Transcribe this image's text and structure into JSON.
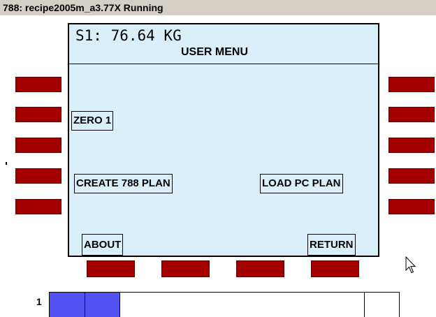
{
  "window": {
    "title": "788: recipe2005m_a3.77X Running"
  },
  "display": {
    "weight_readout": "S1: 76.64 KG",
    "menu_title": "USER MENU",
    "buttons": {
      "zero": "ZERO 1",
      "create_plan": "CREATE 788 PLAN",
      "load_plan": "LOAD PC PLAN",
      "about": "ABOUT",
      "return": "RETURN"
    }
  },
  "softkeys": {
    "color": "#a50000",
    "left_count": 5,
    "right_count": 5,
    "bottom_count": 4
  },
  "progress": {
    "index_label": "1",
    "fill_fraction": 0.2,
    "fill_color": "#5252f0",
    "segment_fractions": [
      0.1,
      0.2,
      0.9
    ]
  },
  "icons": {
    "cursor": "mouse-pointer-icon"
  },
  "colors": {
    "screen_background": "#d9f0fa",
    "titlebar_background": "#d4d0c8"
  }
}
